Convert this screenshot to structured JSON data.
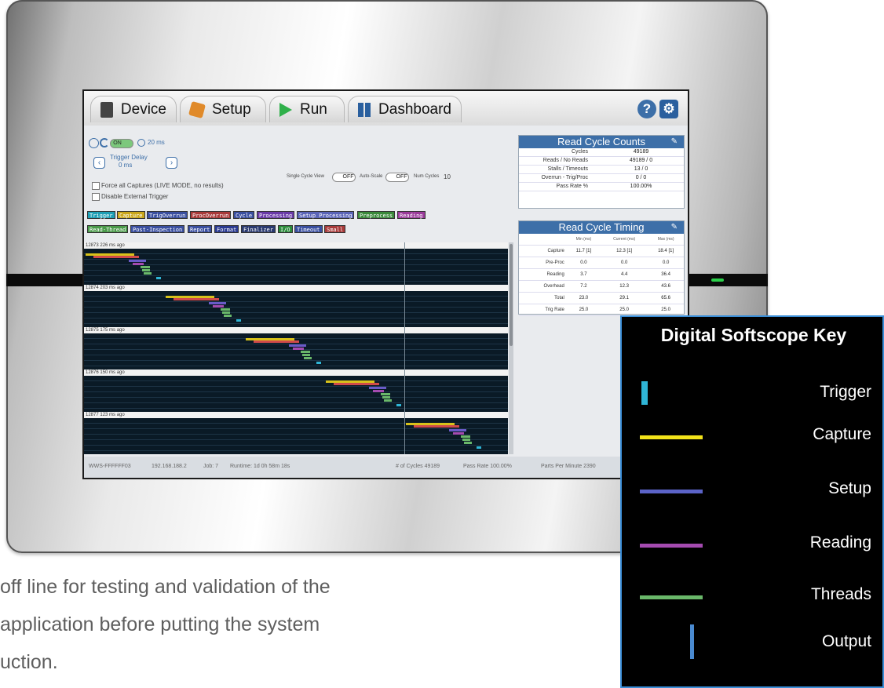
{
  "nav": {
    "tabs": [
      {
        "label": "Device",
        "icon": "device-icon"
      },
      {
        "label": "Setup",
        "icon": "setup-icon"
      },
      {
        "label": "Run",
        "icon": "play-icon"
      },
      {
        "label": "Dashboard",
        "icon": "dashboard-icon"
      }
    ],
    "help_glyph": "?",
    "settings_icon": "gear-icon"
  },
  "controls": {
    "on_label": "ON",
    "timer_value": "20 ms",
    "trigger_delay_label": "Trigger Delay",
    "trigger_delay_value": "0 ms",
    "force_captures_label": "Force all Captures (LIVE MODE, no results)",
    "disable_trigger_label": "Disable External Trigger",
    "single_cycle_view_label": "Single Cycle View",
    "single_cycle_toggle": "OFF",
    "auto_scale_label": "Auto-Scale",
    "auto_scale_toggle": "OFF",
    "num_cycles_label": "Num Cycles",
    "num_cycles_value": "10"
  },
  "legend_chips": [
    {
      "label": "Trigger",
      "color": "#1e9fb5"
    },
    {
      "label": "Capture",
      "color": "#caa61a"
    },
    {
      "label": "TrigOverrun",
      "color": "#3a4fa0"
    },
    {
      "label": "ProcOverrun",
      "color": "#a83a3a"
    },
    {
      "label": "Cycle",
      "color": "#3a4fa0"
    },
    {
      "label": "Processing",
      "color": "#6a3aa8"
    },
    {
      "label": "Setup Processing",
      "color": "#5a64b8"
    },
    {
      "label": "Preprocess",
      "color": "#3a8a3a"
    },
    {
      "label": "Reading",
      "color": "#9a3a9a"
    },
    {
      "label": "Read-Thread",
      "color": "#4a9a4a"
    },
    {
      "label": "Post-Inspection",
      "color": "#3a4fa0"
    },
    {
      "label": "Report",
      "color": "#3a4fa0"
    },
    {
      "label": "Format",
      "color": "#2a3a90"
    },
    {
      "label": "Finalizer",
      "color": "#2a3a70"
    },
    {
      "label": "I/O",
      "color": "#2a8a3a"
    },
    {
      "label": "Timeout",
      "color": "#3a4fa0"
    },
    {
      "label": "Small",
      "color": "#a83a3a"
    }
  ],
  "scope": {
    "cycles": [
      {
        "label": "12873 226 ms ago"
      },
      {
        "label": "12874 203 ms ago"
      },
      {
        "label": "12875 175 ms ago"
      },
      {
        "label": "12876 150 ms ago"
      },
      {
        "label": "12877 123 ms ago"
      }
    ]
  },
  "status": {
    "device": "WWS-FFFFFF03",
    "ip": "192.168.188.2",
    "job": "Job: 7",
    "uptime": "Runtime: 1d 0h 58m 18s",
    "cycles": "# of Cycles 49189",
    "pass_rate": "Pass Rate 100.00%",
    "ppm": "Parts Per Minute 2390"
  },
  "read_cycle_counts": {
    "title": "Read Cycle Counts",
    "rows": [
      {
        "label": "Cycles",
        "value": "49189"
      },
      {
        "label": "Reads / No Reads",
        "value": "49189 / 0"
      },
      {
        "label": "Stalls / Timeouts",
        "value": "13 / 0"
      },
      {
        "label": "Overrun - Trig/Proc",
        "value": "0 / 0"
      },
      {
        "label": "Pass Rate %",
        "value": "100.00%"
      }
    ]
  },
  "read_cycle_timing": {
    "title": "Read Cycle Timing",
    "headers": [
      "",
      "Min (ms)",
      "Current (ms)",
      "Max (ms)"
    ],
    "rows": [
      [
        "Capture",
        "11.7 [1]",
        "12.3 [1]",
        "18.4 [1]"
      ],
      [
        "Pre-Proc",
        "0.0",
        "0.0",
        "0.0"
      ],
      [
        "Reading",
        "3.7",
        "4.4",
        "36.4"
      ],
      [
        "Overhead",
        "7.2",
        "12.3",
        "43.6"
      ],
      [
        "Total",
        "23.0",
        "29.1",
        "65.6"
      ],
      [
        "Trig Rate",
        "25.0",
        "25.0",
        "25.0"
      ]
    ]
  },
  "softscope_key": {
    "title": "Digital Softscope Key",
    "items": [
      {
        "label": "Trigger",
        "color": "#2fb5d6"
      },
      {
        "label": "Capture",
        "color": "#f2e21a"
      },
      {
        "label": "Setup",
        "color": "#5b63c8"
      },
      {
        "label": "Reading",
        "color": "#a44bb0"
      },
      {
        "label": "Threads",
        "color": "#6ab86a"
      },
      {
        "label": "Output",
        "color": "#4a8ad0"
      }
    ]
  },
  "caption": {
    "line1": "off line for testing and validation of the",
    "line2": "application before putting the system",
    "line3": "uction."
  }
}
